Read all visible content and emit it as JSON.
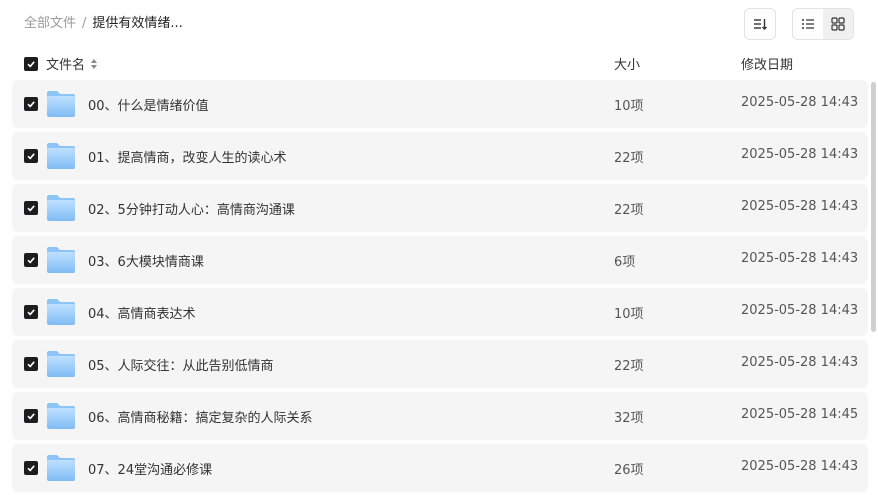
{
  "breadcrumb": {
    "root": "全部文件",
    "separator": "/",
    "current": "提供有效情绪..."
  },
  "toolbar": {
    "sort_icon": "sort-descending-icon",
    "list_view_icon": "list-view-icon",
    "grid_view_icon": "grid-view-icon",
    "active_view": "grid"
  },
  "table": {
    "columns": {
      "name": "文件名",
      "size": "大小",
      "modified": "修改日期"
    },
    "rows": [
      {
        "name": "00、什么是情绪价值",
        "size": "10项",
        "modified": "2025-05-28 14:43",
        "checked": true
      },
      {
        "name": "01、提高情商，改变人生的读心术",
        "size": "22项",
        "modified": "2025-05-28 14:43",
        "checked": true
      },
      {
        "name": "02、5分钟打动人心：高情商沟通课",
        "size": "22项",
        "modified": "2025-05-28 14:43",
        "checked": true
      },
      {
        "name": "03、6大模块情商课",
        "size": "6项",
        "modified": "2025-05-28 14:43",
        "checked": true
      },
      {
        "name": "04、高情商表达术",
        "size": "10项",
        "modified": "2025-05-28 14:43",
        "checked": true
      },
      {
        "name": "05、人际交往：从此告别低情商",
        "size": "22项",
        "modified": "2025-05-28 14:43",
        "checked": true
      },
      {
        "name": "06、高情商秘籍：搞定复杂的人际关系",
        "size": "32项",
        "modified": "2025-05-28 14:45",
        "checked": true
      },
      {
        "name": "07、24堂沟通必修课",
        "size": "26项",
        "modified": "2025-05-28 14:43",
        "checked": true
      }
    ]
  },
  "colors": {
    "row_background": "#f5f5f5",
    "checkbox": "#1d1d1f",
    "folder_light": "#bfe0ff",
    "folder_dark": "#7fbcf5"
  }
}
